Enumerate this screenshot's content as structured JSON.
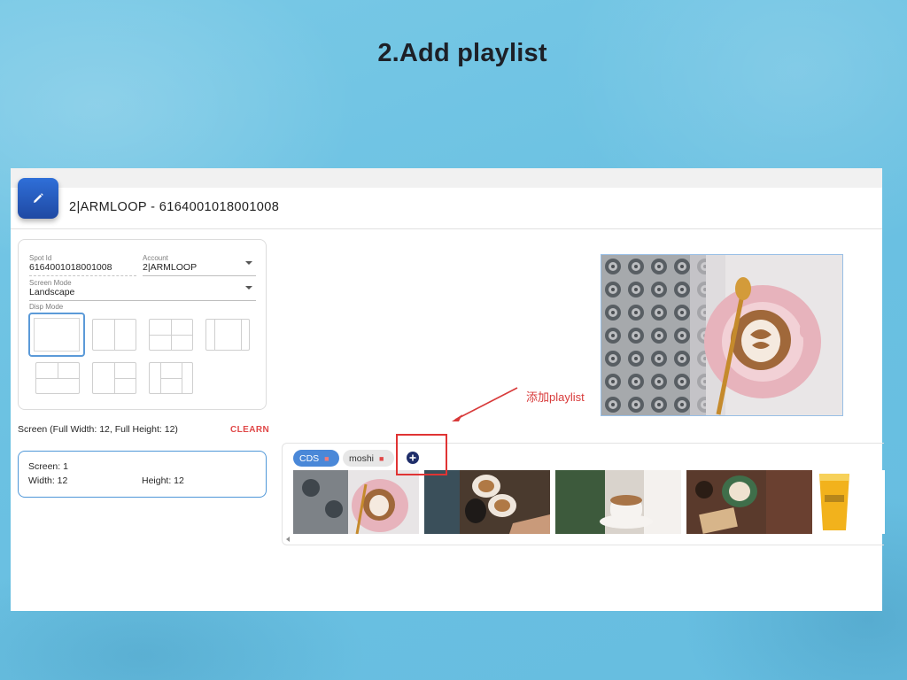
{
  "slide": {
    "title": "2.Add playlist"
  },
  "header": {
    "title": "2|ARMLOOP - 6164001018001008"
  },
  "spot": {
    "spot_id_label": "Spot Id",
    "spot_id_value": "6164001018001008",
    "account_label": "Account",
    "account_value": "2|ARMLOOP",
    "screen_mode_label": "Screen Mode",
    "screen_mode_value": "Landscape",
    "disp_mode_label": "Disp Mode"
  },
  "screen": {
    "label": "Screen (Full Width: 12, Full Height: 12)",
    "clear_label": "CLEARN",
    "screen_line": "Screen:  1",
    "width_line": "Width:  12",
    "height_line": "Height:  12"
  },
  "annotation": {
    "text": "添加playlist",
    "color": "#d83a3a"
  },
  "playlists": [
    {
      "name": "CDS",
      "selected": true
    },
    {
      "name": "moshi",
      "selected": false
    }
  ],
  "colors": {
    "accent": "#4a88d8",
    "danger": "#e04848",
    "brand": "#1f49a3"
  },
  "icons": {
    "edit": "pencil-icon",
    "add": "plus-circle-icon",
    "delete": "trash-icon"
  }
}
